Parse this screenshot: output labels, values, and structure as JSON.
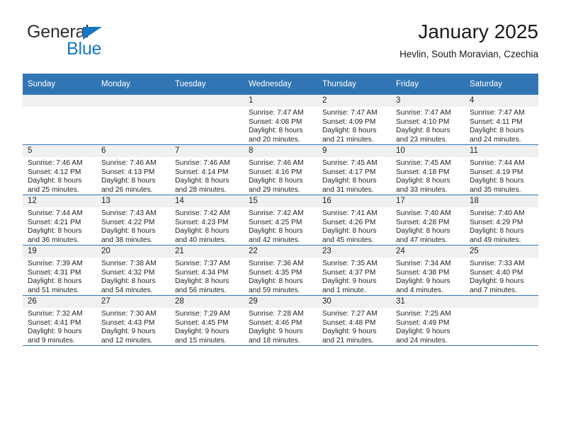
{
  "brand": {
    "name_part1": "General",
    "name_part2": "Blue",
    "triangle_color": "#1577c4",
    "text_color": "#2f2f2f"
  },
  "header": {
    "title": "January 2025",
    "subtitle": "Hevlin, South Moravian, Czechia",
    "header_bg": "#3275b4",
    "date_band_bg": "#f0f0f0"
  },
  "weekday_headers": [
    "Sunday",
    "Monday",
    "Tuesday",
    "Wednesday",
    "Thursday",
    "Friday",
    "Saturday"
  ],
  "weeks": [
    [
      {
        "date": "",
        "empty": true,
        "sunrise": "",
        "sunset": "",
        "daylight_line1": "",
        "daylight_line2": ""
      },
      {
        "date": "",
        "empty": true,
        "sunrise": "",
        "sunset": "",
        "daylight_line1": "",
        "daylight_line2": ""
      },
      {
        "date": "",
        "empty": true,
        "sunrise": "",
        "sunset": "",
        "daylight_line1": "",
        "daylight_line2": ""
      },
      {
        "date": "1",
        "empty": false,
        "sunrise": "Sunrise: 7:47 AM",
        "sunset": "Sunset: 4:08 PM",
        "daylight_line1": "Daylight: 8 hours",
        "daylight_line2": "and 20 minutes."
      },
      {
        "date": "2",
        "empty": false,
        "sunrise": "Sunrise: 7:47 AM",
        "sunset": "Sunset: 4:09 PM",
        "daylight_line1": "Daylight: 8 hours",
        "daylight_line2": "and 21 minutes."
      },
      {
        "date": "3",
        "empty": false,
        "sunrise": "Sunrise: 7:47 AM",
        "sunset": "Sunset: 4:10 PM",
        "daylight_line1": "Daylight: 8 hours",
        "daylight_line2": "and 23 minutes."
      },
      {
        "date": "4",
        "empty": false,
        "sunrise": "Sunrise: 7:47 AM",
        "sunset": "Sunset: 4:11 PM",
        "daylight_line1": "Daylight: 8 hours",
        "daylight_line2": "and 24 minutes."
      }
    ],
    [
      {
        "date": "5",
        "empty": false,
        "sunrise": "Sunrise: 7:46 AM",
        "sunset": "Sunset: 4:12 PM",
        "daylight_line1": "Daylight: 8 hours",
        "daylight_line2": "and 25 minutes."
      },
      {
        "date": "6",
        "empty": false,
        "sunrise": "Sunrise: 7:46 AM",
        "sunset": "Sunset: 4:13 PM",
        "daylight_line1": "Daylight: 8 hours",
        "daylight_line2": "and 26 minutes."
      },
      {
        "date": "7",
        "empty": false,
        "sunrise": "Sunrise: 7:46 AM",
        "sunset": "Sunset: 4:14 PM",
        "daylight_line1": "Daylight: 8 hours",
        "daylight_line2": "and 28 minutes."
      },
      {
        "date": "8",
        "empty": false,
        "sunrise": "Sunrise: 7:46 AM",
        "sunset": "Sunset: 4:16 PM",
        "daylight_line1": "Daylight: 8 hours",
        "daylight_line2": "and 29 minutes."
      },
      {
        "date": "9",
        "empty": false,
        "sunrise": "Sunrise: 7:45 AM",
        "sunset": "Sunset: 4:17 PM",
        "daylight_line1": "Daylight: 8 hours",
        "daylight_line2": "and 31 minutes."
      },
      {
        "date": "10",
        "empty": false,
        "sunrise": "Sunrise: 7:45 AM",
        "sunset": "Sunset: 4:18 PM",
        "daylight_line1": "Daylight: 8 hours",
        "daylight_line2": "and 33 minutes."
      },
      {
        "date": "11",
        "empty": false,
        "sunrise": "Sunrise: 7:44 AM",
        "sunset": "Sunset: 4:19 PM",
        "daylight_line1": "Daylight: 8 hours",
        "daylight_line2": "and 35 minutes."
      }
    ],
    [
      {
        "date": "12",
        "empty": false,
        "sunrise": "Sunrise: 7:44 AM",
        "sunset": "Sunset: 4:21 PM",
        "daylight_line1": "Daylight: 8 hours",
        "daylight_line2": "and 36 minutes."
      },
      {
        "date": "13",
        "empty": false,
        "sunrise": "Sunrise: 7:43 AM",
        "sunset": "Sunset: 4:22 PM",
        "daylight_line1": "Daylight: 8 hours",
        "daylight_line2": "and 38 minutes."
      },
      {
        "date": "14",
        "empty": false,
        "sunrise": "Sunrise: 7:42 AM",
        "sunset": "Sunset: 4:23 PM",
        "daylight_line1": "Daylight: 8 hours",
        "daylight_line2": "and 40 minutes."
      },
      {
        "date": "15",
        "empty": false,
        "sunrise": "Sunrise: 7:42 AM",
        "sunset": "Sunset: 4:25 PM",
        "daylight_line1": "Daylight: 8 hours",
        "daylight_line2": "and 42 minutes."
      },
      {
        "date": "16",
        "empty": false,
        "sunrise": "Sunrise: 7:41 AM",
        "sunset": "Sunset: 4:26 PM",
        "daylight_line1": "Daylight: 8 hours",
        "daylight_line2": "and 45 minutes."
      },
      {
        "date": "17",
        "empty": false,
        "sunrise": "Sunrise: 7:40 AM",
        "sunset": "Sunset: 4:28 PM",
        "daylight_line1": "Daylight: 8 hours",
        "daylight_line2": "and 47 minutes."
      },
      {
        "date": "18",
        "empty": false,
        "sunrise": "Sunrise: 7:40 AM",
        "sunset": "Sunset: 4:29 PM",
        "daylight_line1": "Daylight: 8 hours",
        "daylight_line2": "and 49 minutes."
      }
    ],
    [
      {
        "date": "19",
        "empty": false,
        "sunrise": "Sunrise: 7:39 AM",
        "sunset": "Sunset: 4:31 PM",
        "daylight_line1": "Daylight: 8 hours",
        "daylight_line2": "and 51 minutes."
      },
      {
        "date": "20",
        "empty": false,
        "sunrise": "Sunrise: 7:38 AM",
        "sunset": "Sunset: 4:32 PM",
        "daylight_line1": "Daylight: 8 hours",
        "daylight_line2": "and 54 minutes."
      },
      {
        "date": "21",
        "empty": false,
        "sunrise": "Sunrise: 7:37 AM",
        "sunset": "Sunset: 4:34 PM",
        "daylight_line1": "Daylight: 8 hours",
        "daylight_line2": "and 56 minutes."
      },
      {
        "date": "22",
        "empty": false,
        "sunrise": "Sunrise: 7:36 AM",
        "sunset": "Sunset: 4:35 PM",
        "daylight_line1": "Daylight: 8 hours",
        "daylight_line2": "and 59 minutes."
      },
      {
        "date": "23",
        "empty": false,
        "sunrise": "Sunrise: 7:35 AM",
        "sunset": "Sunset: 4:37 PM",
        "daylight_line1": "Daylight: 9 hours",
        "daylight_line2": "and 1 minute."
      },
      {
        "date": "24",
        "empty": false,
        "sunrise": "Sunrise: 7:34 AM",
        "sunset": "Sunset: 4:38 PM",
        "daylight_line1": "Daylight: 9 hours",
        "daylight_line2": "and 4 minutes."
      },
      {
        "date": "25",
        "empty": false,
        "sunrise": "Sunrise: 7:33 AM",
        "sunset": "Sunset: 4:40 PM",
        "daylight_line1": "Daylight: 9 hours",
        "daylight_line2": "and 7 minutes."
      }
    ],
    [
      {
        "date": "26",
        "empty": false,
        "sunrise": "Sunrise: 7:32 AM",
        "sunset": "Sunset: 4:41 PM",
        "daylight_line1": "Daylight: 9 hours",
        "daylight_line2": "and 9 minutes."
      },
      {
        "date": "27",
        "empty": false,
        "sunrise": "Sunrise: 7:30 AM",
        "sunset": "Sunset: 4:43 PM",
        "daylight_line1": "Daylight: 9 hours",
        "daylight_line2": "and 12 minutes."
      },
      {
        "date": "28",
        "empty": false,
        "sunrise": "Sunrise: 7:29 AM",
        "sunset": "Sunset: 4:45 PM",
        "daylight_line1": "Daylight: 9 hours",
        "daylight_line2": "and 15 minutes."
      },
      {
        "date": "29",
        "empty": false,
        "sunrise": "Sunrise: 7:28 AM",
        "sunset": "Sunset: 4:46 PM",
        "daylight_line1": "Daylight: 9 hours",
        "daylight_line2": "and 18 minutes."
      },
      {
        "date": "30",
        "empty": false,
        "sunrise": "Sunrise: 7:27 AM",
        "sunset": "Sunset: 4:48 PM",
        "daylight_line1": "Daylight: 9 hours",
        "daylight_line2": "and 21 minutes."
      },
      {
        "date": "31",
        "empty": false,
        "sunrise": "Sunrise: 7:25 AM",
        "sunset": "Sunset: 4:49 PM",
        "daylight_line1": "Daylight: 9 hours",
        "daylight_line2": "and 24 minutes."
      },
      {
        "date": "",
        "empty": true,
        "sunrise": "",
        "sunset": "",
        "daylight_line1": "",
        "daylight_line2": ""
      }
    ]
  ]
}
